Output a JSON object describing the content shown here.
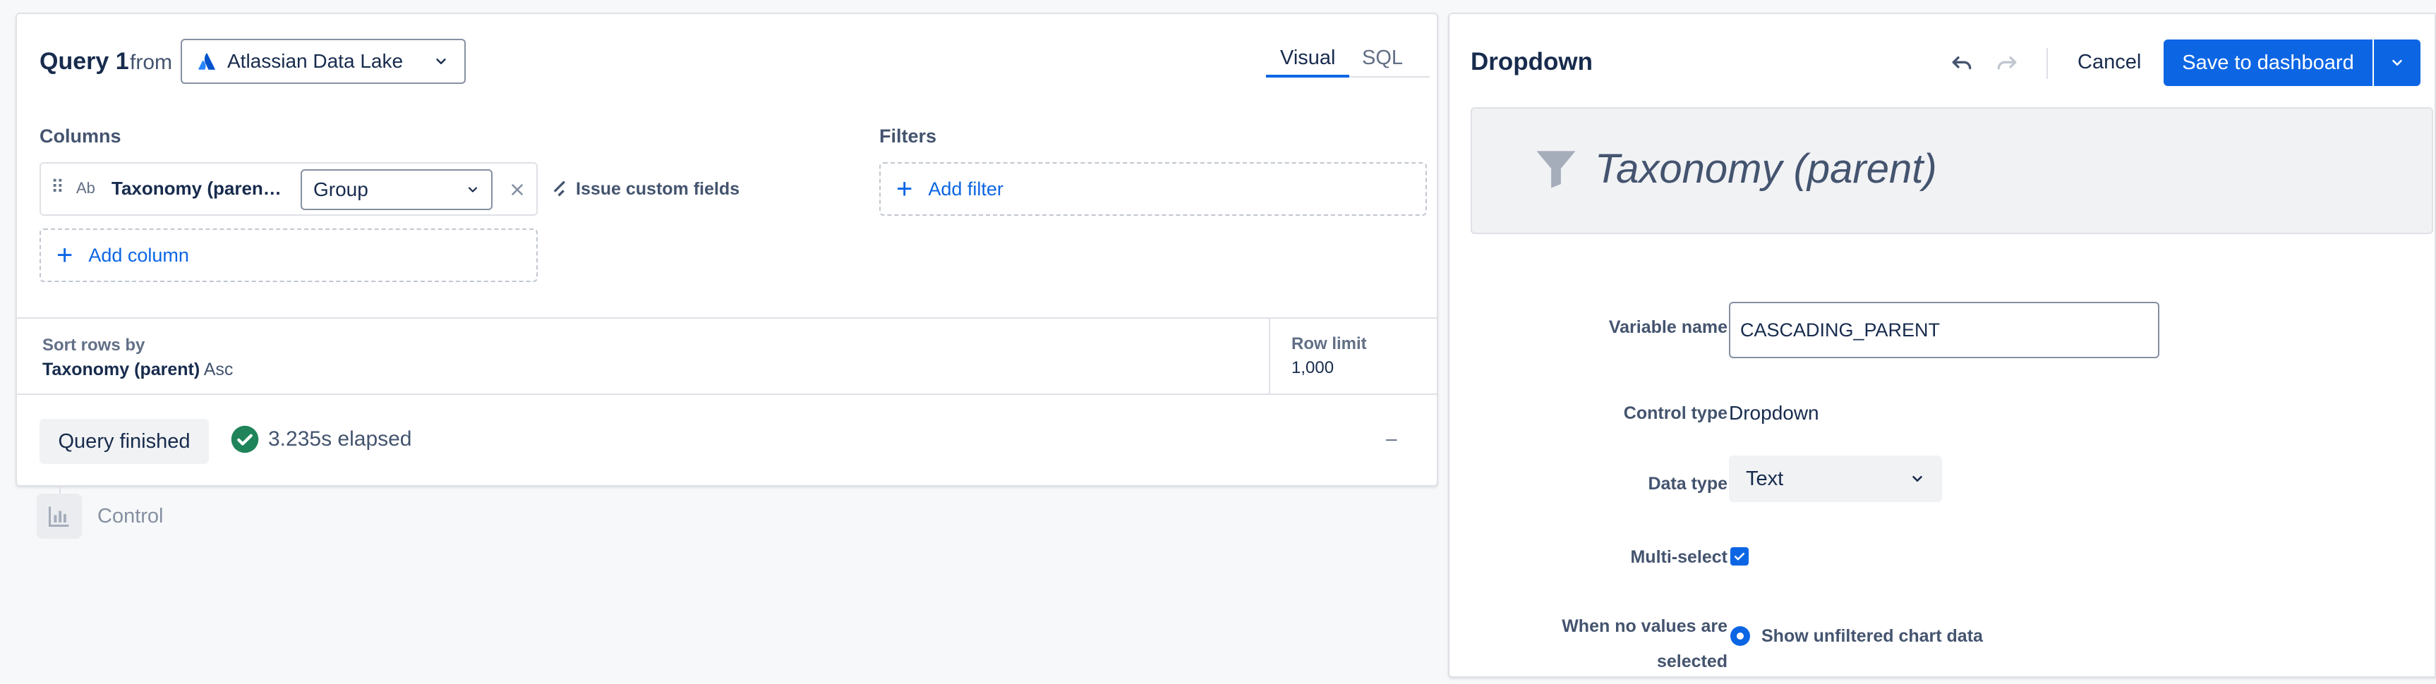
{
  "query": {
    "title": "Query 1",
    "from_label": "from",
    "datasource": "Atlassian Data Lake",
    "view_tabs": [
      {
        "label": "Visual",
        "active": true
      },
      {
        "label": "SQL",
        "active": false
      }
    ],
    "columns_heading": "Columns",
    "filters_heading": "Filters",
    "column_chip": {
      "type_label": "Ab",
      "name": "Taxonomy (paren…",
      "aggregation": "Group"
    },
    "issue_custom_fields_label": "Issue custom fields",
    "add_column_label": "Add column",
    "add_filter_label": "Add filter",
    "sort_label": "Sort rows by",
    "sort_field": "Taxonomy (parent)",
    "sort_direction": "Asc",
    "row_limit_label": "Row limit",
    "row_limit_value": "1,000",
    "status_button": "Query finished",
    "elapsed": "3.235s elapsed",
    "collapse_glyph": "–"
  },
  "control_step": {
    "label": "Control",
    "icon": "chart-icon"
  },
  "panel": {
    "title": "Dropdown",
    "cancel_label": "Cancel",
    "save_label": "Save to dashboard",
    "preview_title": "Taxonomy (parent)",
    "preview_icon": "filter-icon",
    "fields": {
      "variable_name_label": "Variable name",
      "variable_name_value": "CASCADING_PARENT",
      "control_type_label": "Control type",
      "control_type_value": "Dropdown",
      "data_type_label": "Data type",
      "data_type_value": "Text",
      "multi_select_label": "Multi-select",
      "multi_select_checked": true,
      "no_values_label_line1": "When no values are",
      "no_values_label_line2": "selected",
      "no_values_option": "Show unfiltered chart data"
    }
  },
  "colors": {
    "accent": "#0c66e4",
    "success": "#1f845a",
    "border": "#dfe1e6"
  }
}
